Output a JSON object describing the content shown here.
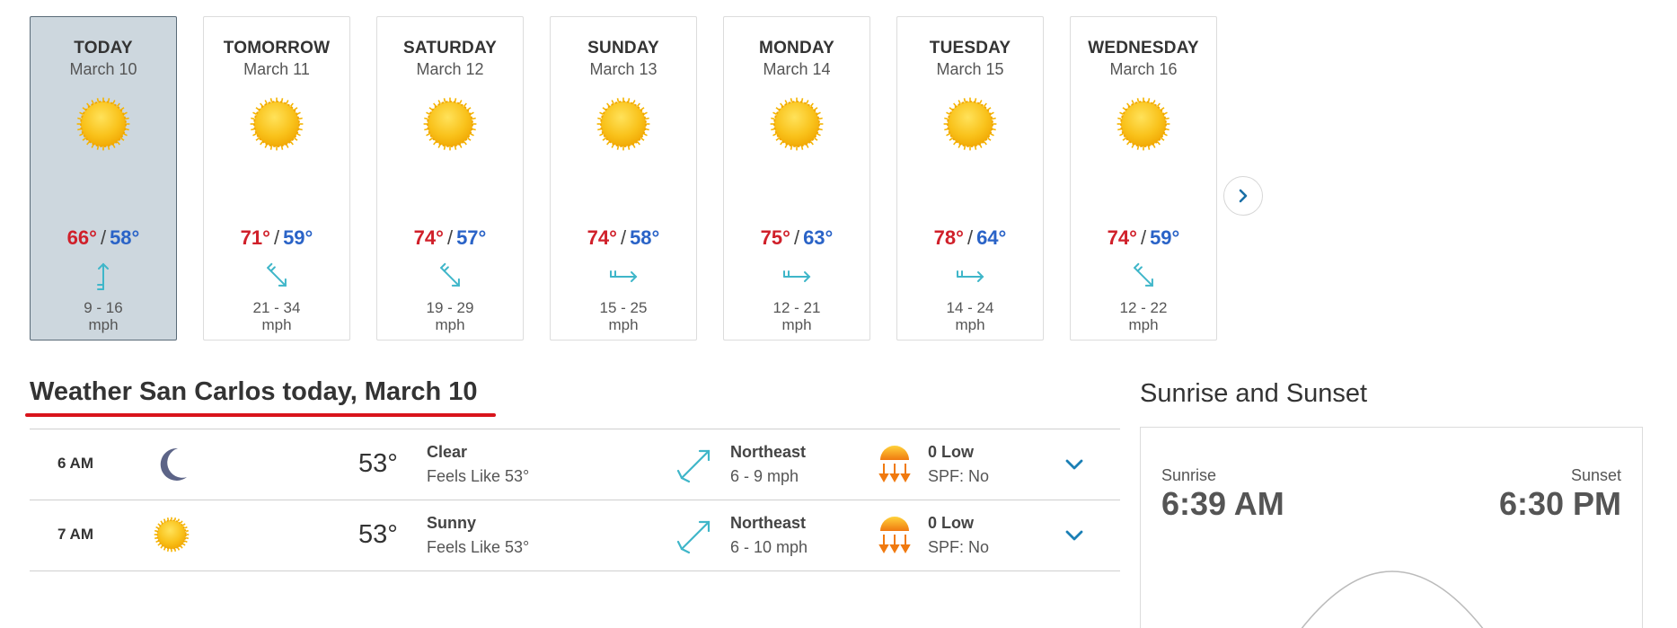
{
  "forecast": {
    "days": [
      {
        "name": "TODAY",
        "date": "March 10",
        "hi": "66°",
        "lo": "58°",
        "wind": "9 - 16",
        "unit": "mph",
        "wind_rotation": 0
      },
      {
        "name": "TOMORROW",
        "date": "March 11",
        "hi": "71°",
        "lo": "59°",
        "wind": "21 - 34",
        "unit": "mph",
        "wind_rotation": 135
      },
      {
        "name": "SATURDAY",
        "date": "March 12",
        "hi": "74°",
        "lo": "57°",
        "wind": "19 - 29",
        "unit": "mph",
        "wind_rotation": 135
      },
      {
        "name": "SUNDAY",
        "date": "March 13",
        "hi": "74°",
        "lo": "58°",
        "wind": "15 - 25",
        "unit": "mph",
        "wind_rotation": 90
      },
      {
        "name": "MONDAY",
        "date": "March 14",
        "hi": "75°",
        "lo": "63°",
        "wind": "12 - 21",
        "unit": "mph",
        "wind_rotation": 90
      },
      {
        "name": "TUESDAY",
        "date": "March 15",
        "hi": "78°",
        "lo": "64°",
        "wind": "14 - 24",
        "unit": "mph",
        "wind_rotation": 90
      },
      {
        "name": "WEDNESDAY",
        "date": "March 16",
        "hi": "74°",
        "lo": "59°",
        "wind": "12 - 22",
        "unit": "mph",
        "wind_rotation": 135
      }
    ],
    "sep": "/",
    "next_icon": "chevron-right-icon"
  },
  "today": {
    "title": "Weather San Carlos today, March 10",
    "hours": [
      {
        "time": "6 AM",
        "icon": "moon-icon",
        "temp": "53°",
        "cond": "Clear",
        "feels": "Feels Like 53°",
        "wind_dir": "Northeast",
        "wind_speed": "6 - 9 mph",
        "uv": "0 Low",
        "spf": "SPF: No"
      },
      {
        "time": "7 AM",
        "icon": "sun-icon",
        "temp": "53°",
        "cond": "Sunny",
        "feels": "Feels Like 53°",
        "wind_dir": "Northeast",
        "wind_speed": "6 - 10 mph",
        "uv": "0 Low",
        "spf": "SPF: No"
      }
    ]
  },
  "sun": {
    "title": "Sunrise and Sunset",
    "sunrise_label": "Sunrise",
    "sunrise_time": "6:39 AM",
    "sunset_label": "Sunset",
    "sunset_time": "6:30 PM"
  },
  "colors": {
    "high": "#d0202a",
    "low": "#2a63c7",
    "accent": "#1a7fb5",
    "wind_icon": "#3fb6c9",
    "title_underline": "#d8141b",
    "active_card": "#cdd7de"
  }
}
